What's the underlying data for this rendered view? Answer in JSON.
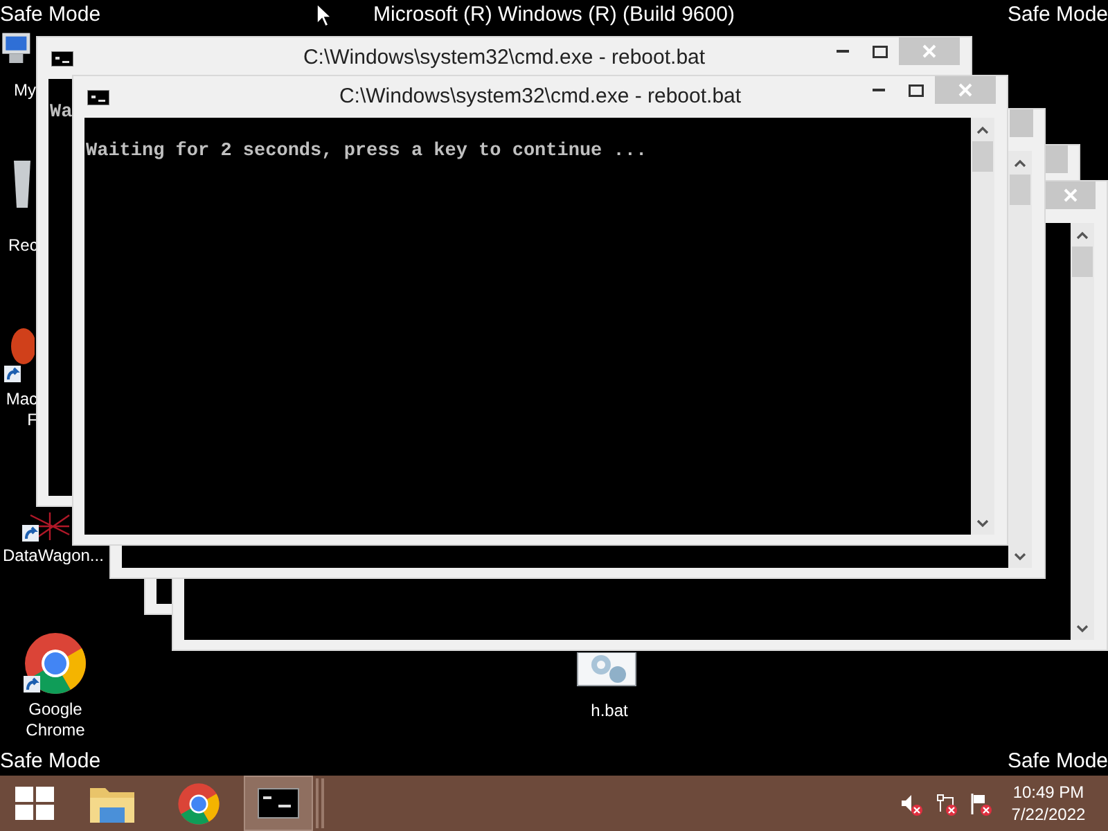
{
  "desktop": {
    "corner_labels": [
      "Safe Mode",
      "Safe Mode",
      "Safe Mode",
      "Safe Mode"
    ],
    "build_text": "Microsoft (R) Windows (R) (Build 9600)",
    "icons": [
      {
        "kind": "computer",
        "lines": [
          "My"
        ]
      },
      {
        "kind": "recycle-bin",
        "lines": [
          "Rec"
        ]
      },
      {
        "kind": "app",
        "lines": [
          "Mac",
          "F"
        ]
      },
      {
        "kind": "network",
        "lines": [
          "DataWagon..."
        ]
      },
      {
        "kind": "browser",
        "lines": [
          "Google",
          "Chrome"
        ]
      },
      {
        "kind": "script",
        "lines": [
          "h.bat"
        ]
      }
    ]
  },
  "windows": [
    {
      "kind": "cmd"
    },
    {
      "kind": "cmd"
    },
    {
      "kind": "cmd"
    },
    {
      "kind": "cmd",
      "title": "C:\\Windows\\system32\\cmd.exe - reboot.bat",
      "console_text": "Wa"
    },
    {
      "kind": "cmd",
      "title": "C:\\Windows\\system32\\cmd.exe - reboot.bat",
      "console_text": "Waiting for 2 seconds, press a key to continue ..."
    }
  ],
  "taskbar": {
    "apps": [
      {
        "kind": "start",
        "selected": false
      },
      {
        "kind": "explorer",
        "selected": false
      },
      {
        "kind": "browser",
        "selected": false
      },
      {
        "kind": "console",
        "selected": true
      }
    ],
    "tray": [
      {
        "kind": "volume"
      },
      {
        "kind": "network"
      },
      {
        "kind": "flag"
      }
    ],
    "time": "10:49 PM",
    "date": "7/22/2022"
  }
}
